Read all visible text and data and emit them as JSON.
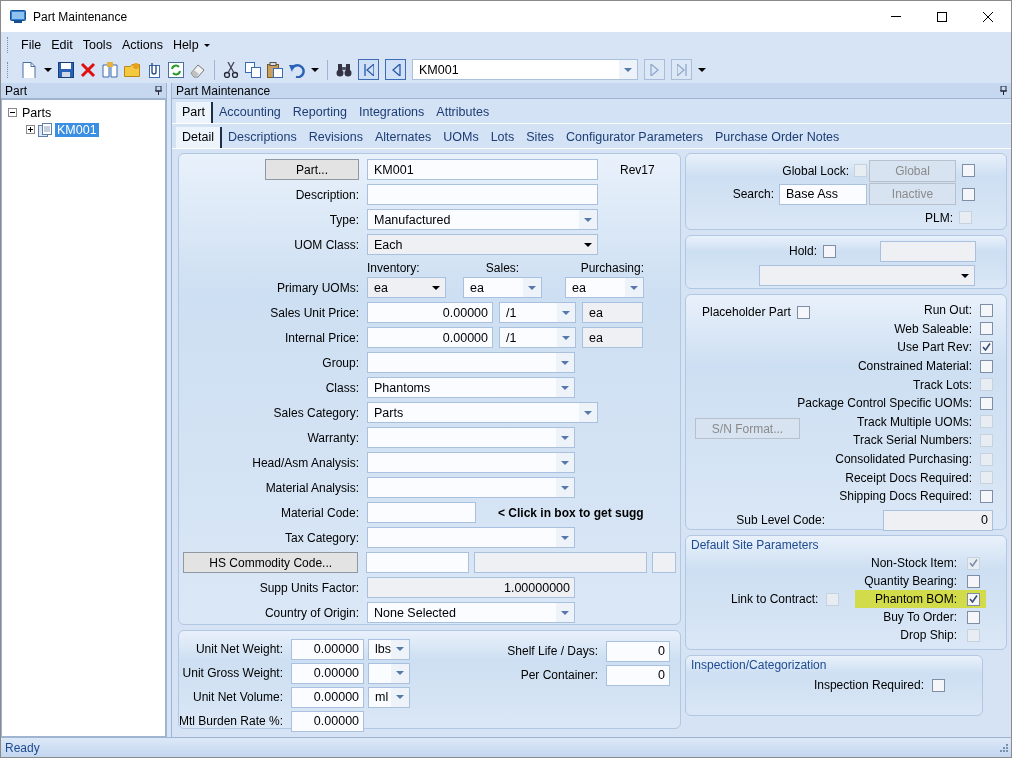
{
  "window": {
    "title": "Part Maintenance"
  },
  "menu": [
    "File",
    "Edit",
    "Tools",
    "Actions",
    "Help"
  ],
  "toolbar": {
    "record_value": "KM001"
  },
  "tree_pane": {
    "title": "Part",
    "tree": [
      {
        "label": "Parts",
        "expanded": true,
        "children": [
          {
            "label": "KM001",
            "selected": true,
            "expanded": false
          }
        ]
      }
    ]
  },
  "main": {
    "title": "Part Maintenance",
    "tabs": [
      {
        "label": "Part",
        "selected": true
      },
      {
        "label": "Accounting",
        "selected": false
      },
      {
        "label": "Reporting",
        "selected": false
      },
      {
        "label": "Integrations",
        "selected": false
      },
      {
        "label": "Attributes",
        "selected": false
      }
    ],
    "subtabs": [
      {
        "label": "Detail",
        "selected": true
      },
      {
        "label": "Descriptions",
        "selected": false
      },
      {
        "label": "Revisions",
        "selected": false
      },
      {
        "label": "Alternates",
        "selected": false
      },
      {
        "label": "UOMs",
        "selected": false
      },
      {
        "label": "Lots",
        "selected": false
      },
      {
        "label": "Sites",
        "selected": false
      },
      {
        "label": "Configurator Parameters",
        "selected": false
      },
      {
        "label": "Purchase Order Notes",
        "selected": false
      }
    ]
  },
  "detail": {
    "rows": [
      {
        "kind": "part",
        "button": "Part...",
        "value": "KM001",
        "revision": "Rev17"
      },
      {
        "kind": "text",
        "label": "Description:"
      },
      {
        "kind": "combo-wide",
        "label": "Type:",
        "value": "Manufactured"
      },
      {
        "kind": "dropdown-wide",
        "label": "UOM Class:",
        "value": "Each"
      },
      {
        "kind": "uoms",
        "label": "Primary UOMs:",
        "columns": [
          {
            "header": "Inventory:",
            "value": "ea",
            "kind": "dropdown"
          },
          {
            "header": "Sales:",
            "value": "ea",
            "kind": "combo"
          },
          {
            "header": "Purchasing:",
            "value": "ea",
            "kind": "combo"
          }
        ]
      },
      {
        "kind": "price",
        "label": "Sales Unit Price:",
        "value": "0.00000",
        "per": "/1",
        "unit": "ea"
      },
      {
        "kind": "price",
        "label": "Internal Price:",
        "value": "0.00000",
        "per": "/1",
        "unit": "ea"
      },
      {
        "kind": "combo",
        "label": "Group:"
      },
      {
        "kind": "combo",
        "label": "Class:",
        "value": "Phantoms"
      },
      {
        "kind": "combo-wide",
        "label": "Sales Category:",
        "value": "Parts"
      },
      {
        "kind": "combo",
        "label": "Warranty:"
      },
      {
        "kind": "combo",
        "label": "Head/Asm Analysis:"
      },
      {
        "kind": "combo",
        "label": "Material Analysis:"
      },
      {
        "kind": "code",
        "label": "Material Code:",
        "note": "< Click in box to get sugg"
      },
      {
        "kind": "combo",
        "label": "Tax Category:"
      },
      {
        "kind": "hs",
        "button": "HS Commodity Code..."
      },
      {
        "kind": "readonly",
        "label": "Supp Units Factor:",
        "value": "1.00000000"
      },
      {
        "kind": "combo",
        "label": "Country of Origin:",
        "value": "None Selected"
      }
    ]
  },
  "measures": {
    "rows": [
      {
        "kind": "with-unit",
        "label": "Unit Net Weight:",
        "value": "0.00000",
        "unit": "lbs"
      },
      {
        "kind": "with-unit",
        "label": "Unit Gross Weight:",
        "value": "0.00000"
      },
      {
        "kind": "with-unit",
        "label": "Unit Net Volume:",
        "value": "0.00000",
        "unit": "ml"
      },
      {
        "kind": "plain",
        "label": "Mtl Burden Rate %:",
        "value": "0.00000"
      }
    ],
    "side": [
      {
        "label": "Shelf Life / Days:",
        "value": "0"
      },
      {
        "label": "Per Container:",
        "value": "0"
      }
    ]
  },
  "flags": {
    "global_lock": {
      "label": "Global Lock:",
      "checked": false,
      "disabled": true
    },
    "global_button": {
      "label": "Global",
      "disabled": true,
      "checked": false
    },
    "search": {
      "label": "Search:",
      "value": "Base Ass"
    },
    "inactive_button": {
      "label": "Inactive",
      "disabled": true,
      "checked": false
    },
    "plm": {
      "label": "PLM:",
      "checked": false,
      "disabled": true
    }
  },
  "hold": {
    "label": "Hold:",
    "checked": false
  },
  "options": {
    "placeholder": {
      "label": "Placeholder Part",
      "checked": false,
      "disabled": false
    },
    "checks": [
      {
        "label": "Run Out:",
        "checked": false,
        "disabled": false
      },
      {
        "label": "Web Saleable:",
        "checked": false,
        "disabled": false
      },
      {
        "label": "Use Part Rev:",
        "checked": true,
        "disabled": false
      },
      {
        "label": "Constrained Material:",
        "checked": false,
        "disabled": false
      },
      {
        "label": "Track Lots:",
        "checked": false,
        "disabled": true
      },
      {
        "label": "Package Control Specific UOMs:",
        "checked": false,
        "disabled": false
      },
      {
        "label": "Track Multiple UOMs:",
        "checked": false,
        "disabled": true
      },
      {
        "label": "Track Serial Numbers:",
        "checked": false,
        "disabled": true
      },
      {
        "label": "Consolidated Purchasing:",
        "checked": false,
        "disabled": true
      },
      {
        "label": "Receipt Docs Required:",
        "checked": false,
        "disabled": true
      },
      {
        "label": "Shipping Docs Required:",
        "checked": false,
        "disabled": false
      }
    ],
    "sn_button": {
      "label": "S/N Format...",
      "disabled": true
    },
    "sub_level": {
      "label": "Sub Level Code:",
      "value": "0"
    }
  },
  "site_parameters": {
    "title": "Default Site Parameters",
    "link": {
      "label": "Link to Contract:",
      "checked": false,
      "disabled": true
    },
    "checks": [
      {
        "label": "Non-Stock Item:",
        "checked": true,
        "disabled": true,
        "highlighted": false
      },
      {
        "label": "Quantity Bearing:",
        "checked": false,
        "disabled": false,
        "highlighted": false
      },
      {
        "label": "Phantom BOM:",
        "checked": true,
        "disabled": false,
        "highlighted": true
      },
      {
        "label": "Buy To Order:",
        "checked": false,
        "disabled": false,
        "highlighted": false
      },
      {
        "label": "Drop Ship:",
        "checked": false,
        "disabled": true,
        "highlighted": false
      }
    ]
  },
  "inspection": {
    "title": "Inspection/Categorization",
    "check": {
      "label": "Inspection Required:",
      "checked": false,
      "disabled": false
    }
  },
  "status_bar": "Ready"
}
